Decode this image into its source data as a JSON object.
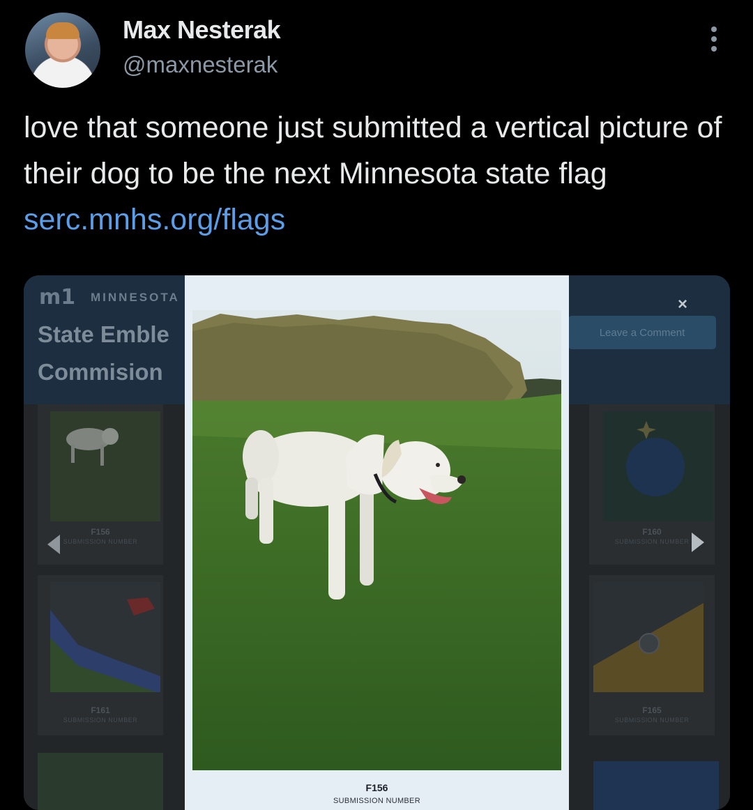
{
  "tweet": {
    "author_name": "Max Nesterak",
    "author_handle": "@maxnesterak",
    "text": "love that someone just submitted a vertical picture of their dog to be the next Minnesota state flag ",
    "link": "serc.mnhs.org/flags"
  },
  "site": {
    "logo": "m1",
    "brand": "MINNESOTA",
    "title": "State Emble Commision",
    "close_label": "×",
    "comment_button": "Leave a Comment"
  },
  "submissions": [
    {
      "number": "F156",
      "label": "SUBMISSION NUMBER"
    },
    {
      "number": "F160",
      "label": "SUBMISSION NUMBER"
    },
    {
      "number": "F161",
      "label": "SUBMISSION NUMBER"
    },
    {
      "number": "F165",
      "label": "SUBMISSION NUMBER"
    }
  ],
  "modal": {
    "number": "F156",
    "label": "SUBMISSION NUMBER"
  },
  "colors": {
    "link": "#5b9de6",
    "background": "#000000",
    "modal_bg": "#e4eef4"
  },
  "icons": [
    "more-icon",
    "close-icon",
    "arrow-left-icon",
    "arrow-right-icon"
  ]
}
